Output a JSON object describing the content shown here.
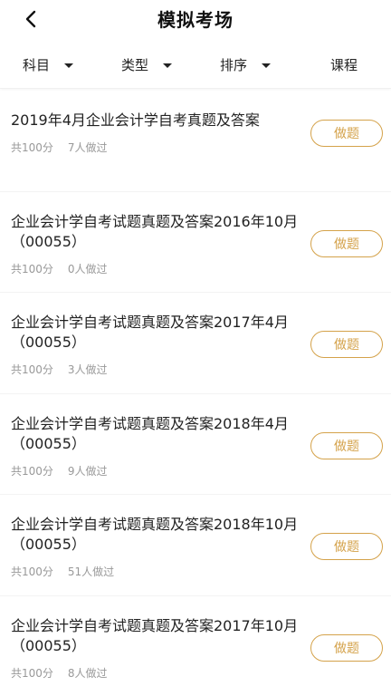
{
  "header": {
    "title": "模拟考场",
    "back_icon": "chevron-left-icon"
  },
  "filters": {
    "subject": "科目",
    "type": "类型",
    "sort": "排序",
    "course": "课程"
  },
  "colors": {
    "accent": "#d4a24a",
    "meta": "#999999"
  },
  "exams": [
    {
      "title": "2019年4月企业会计学自考真题及答案",
      "score": "共100分",
      "done": "7人做过",
      "button": "做题"
    },
    {
      "title": "企业会计学自考试题真题及答案2016年10月（00055）",
      "score": "共100分",
      "done": "0人做过",
      "button": "做题"
    },
    {
      "title": "企业会计学自考试题真题及答案2017年4月（00055）",
      "score": "共100分",
      "done": "3人做过",
      "button": "做题"
    },
    {
      "title": "企业会计学自考试题真题及答案2018年4月（00055）",
      "score": "共100分",
      "done": "9人做过",
      "button": "做题"
    },
    {
      "title": "企业会计学自考试题真题及答案2018年10月（00055）",
      "score": "共100分",
      "done": "51人做过",
      "button": "做题"
    },
    {
      "title": "企业会计学自考试题真题及答案2017年10月（00055）",
      "score": "共100分",
      "done": "8人做过",
      "button": "做题"
    }
  ]
}
